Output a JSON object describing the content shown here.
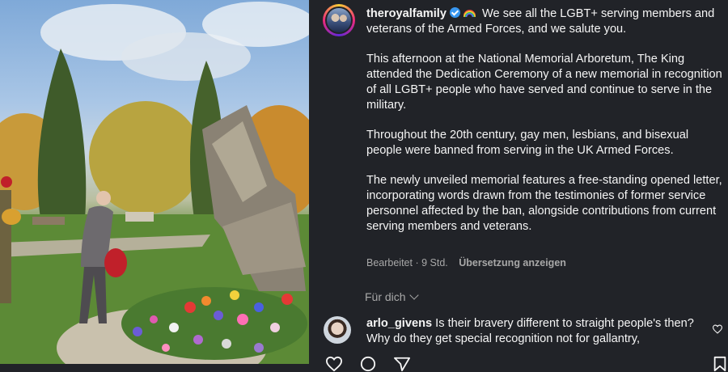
{
  "post": {
    "username": "theroyalfamily",
    "caption_intro": " We see all the LGBT+ serving members and veterans of the Armed Forces, and we salute you.",
    "paragraph_1_part_1": "This afternoon at the National Memorial Arboretum, The King attended the Dedication Ceremony of a new memorial in recognition of all LGBT+ people who have served and continue to serve in the",
    "paragraph_1_part_2": "military.",
    "paragraph_2": "Throughout the 20th century, gay men, lesbians, and bisexual people were banned from serving in the UK Armed Forces.",
    "paragraph_3": "The newly unveiled memorial features a free-standing opened letter, incorporating words drawn from the testimonies of former service personnel affected by the ban, alongside contributions from current serving members and veterans.",
    "edited_label": "Bearbeitet",
    "separator": " · ",
    "time_ago": "9 Std.",
    "translate_label": "Übersetzung anzeigen"
  },
  "feed": {
    "for_you_label": "Für dich"
  },
  "comment": {
    "username": "arlo_givens",
    "text": " Is their bravery different to straight people's then? Why do they get special recognition not for gallantry,"
  },
  "icons": {
    "verified": "verified-badge-icon",
    "rainbow": "rainbow-emoji-icon",
    "chevron": "chevron-down-icon",
    "heart": "heart-icon",
    "comment": "comment-icon",
    "share": "share-icon",
    "bookmark": "bookmark-icon"
  },
  "colors": {
    "background": "#212328",
    "text": "#f5f5f5",
    "muted": "#a8a8a8",
    "verified": "#3897f0"
  }
}
